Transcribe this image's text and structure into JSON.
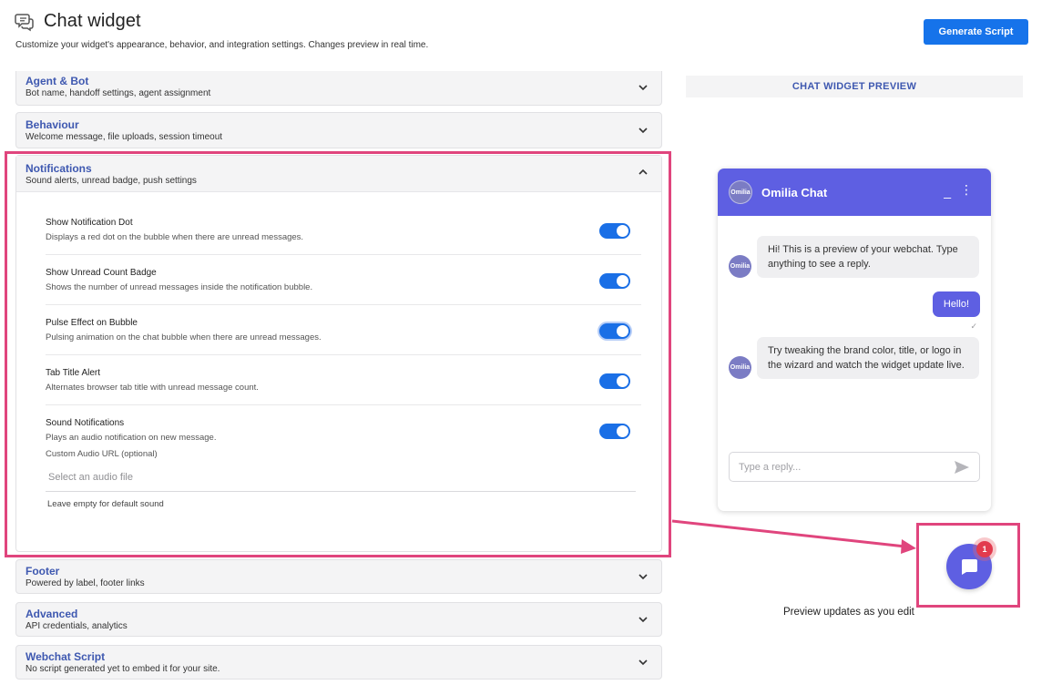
{
  "header": {
    "title": "Chat widget",
    "subtitle": "Customize your widget's appearance, behavior, and integration settings. Changes preview in real time.",
    "generate_button": "Generate Script"
  },
  "sections": {
    "agent_bot": {
      "title": "Agent & Bot",
      "desc": "Bot name, handoff settings, agent assignment"
    },
    "behaviour": {
      "title": "Behaviour",
      "desc": "Welcome message, file uploads, session timeout"
    },
    "notifications": {
      "title": "Notifications",
      "desc": "Sound alerts, unread badge, push settings"
    },
    "footer": {
      "title": "Footer",
      "desc": "Powered by label, footer links"
    },
    "advanced": {
      "title": "Advanced",
      "desc": "API credentials, analytics"
    },
    "webchat_script": {
      "title": "Webchat Script",
      "desc": "No script generated yet to embed it for your site."
    }
  },
  "notifications": {
    "settings": [
      {
        "label": "Show Notification Dot",
        "desc": "Displays a red dot on the bubble when there are unread messages.",
        "enabled": true
      },
      {
        "label": "Show Unread Count Badge",
        "desc": "Shows the number of unread messages inside the notification bubble.",
        "enabled": true
      },
      {
        "label": "Pulse Effect on Bubble",
        "desc": "Pulsing animation on the chat bubble when there are unread messages.",
        "enabled": true
      },
      {
        "label": "Tab Title Alert",
        "desc": "Alternates browser tab title with unread message count.",
        "enabled": true
      },
      {
        "label": "Sound Notifications",
        "desc": "Plays an audio notification on new message.",
        "enabled": true
      }
    ],
    "audio_label": "Custom Audio URL (optional)",
    "audio_placeholder": "Select an audio file",
    "audio_value": "",
    "audio_help": "Leave empty for default sound"
  },
  "preview": {
    "header": "CHAT WIDGET PREVIEW",
    "chat_title": "Omilia Chat",
    "avatar_text": "Omilia",
    "min_icon": "_",
    "menu_icon": "⋮",
    "messages": {
      "bot1": "Hi! This is a preview of your webchat. Type anything to see a reply.",
      "user1": "Hello!",
      "bot2": "Try tweaking the brand color, title, or logo in the wizard and watch the widget update live."
    },
    "read_tick": "✓",
    "input_placeholder": "Type a reply...",
    "badge_count": "1",
    "note": "Preview updates as you edit"
  },
  "colors": {
    "primary_button": "#1673ea",
    "section_title": "#3e58b0",
    "chat_accent": "#5e5fe2",
    "toggle_on": "#1a6fe6",
    "highlight": "#e0457d",
    "badge": "#e23b4e"
  },
  "icons": {
    "title": "chat-bubbles-icon",
    "chevron": "chevron-icon",
    "send": "send-icon",
    "launcher": "chat-bubble-icon"
  }
}
